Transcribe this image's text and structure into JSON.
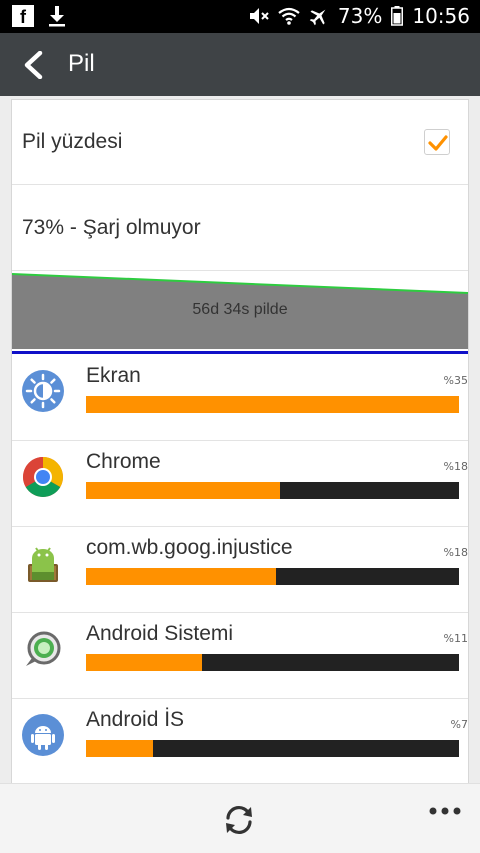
{
  "status_bar": {
    "battery_percent": "73%",
    "time": "10:56",
    "icons": [
      "facebook-icon",
      "download-icon",
      "mute-icon",
      "wifi-icon",
      "airplane-icon",
      "battery-icon"
    ]
  },
  "title_bar": {
    "title": "Pil"
  },
  "battery_percentage_pref": {
    "label": "Pil yüzdesi",
    "checked": true
  },
  "status_row": {
    "text": "73% - Şarj olmuyor"
  },
  "graph": {
    "label": "56d 34s pilde",
    "line_color": "#2ecc40",
    "fill_color": "#808080"
  },
  "usage": [
    {
      "name": "Ekran",
      "percent_label": "%35",
      "fraction": 1.0,
      "icon": "brightness-icon"
    },
    {
      "name": "Chrome",
      "percent_label": "%18",
      "fraction": 0.52,
      "icon": "chrome-icon"
    },
    {
      "name": "com.wb.goog.injustice",
      "percent_label": "%18",
      "fraction": 0.51,
      "icon": "android-package-icon"
    },
    {
      "name": "Android Sistemi",
      "percent_label": "%11",
      "fraction": 0.31,
      "icon": "android-system-icon"
    },
    {
      "name": "Android İS",
      "percent_label": "%7",
      "fraction": 0.18,
      "icon": "android-os-icon"
    }
  ],
  "colors": {
    "accent": "#ff9100",
    "title_bar": "#3f4346",
    "bar_track": "#222222"
  }
}
